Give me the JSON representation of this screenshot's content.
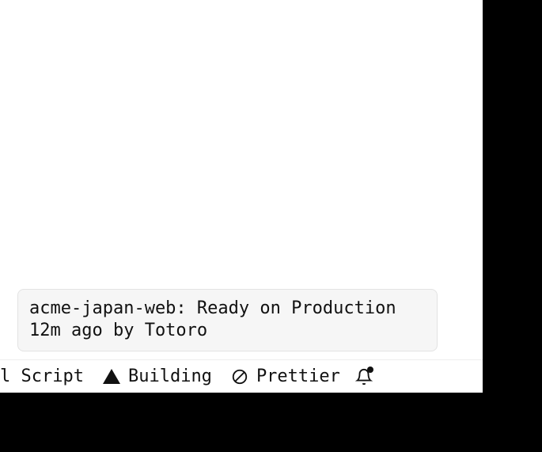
{
  "notification": {
    "line1": "acme-japan-web: Ready on Production",
    "line2": "12m ago by Totoro"
  },
  "statusbar": {
    "script_label_partial": "l Script",
    "build_label": "Building",
    "prettier_label": "Prettier"
  }
}
